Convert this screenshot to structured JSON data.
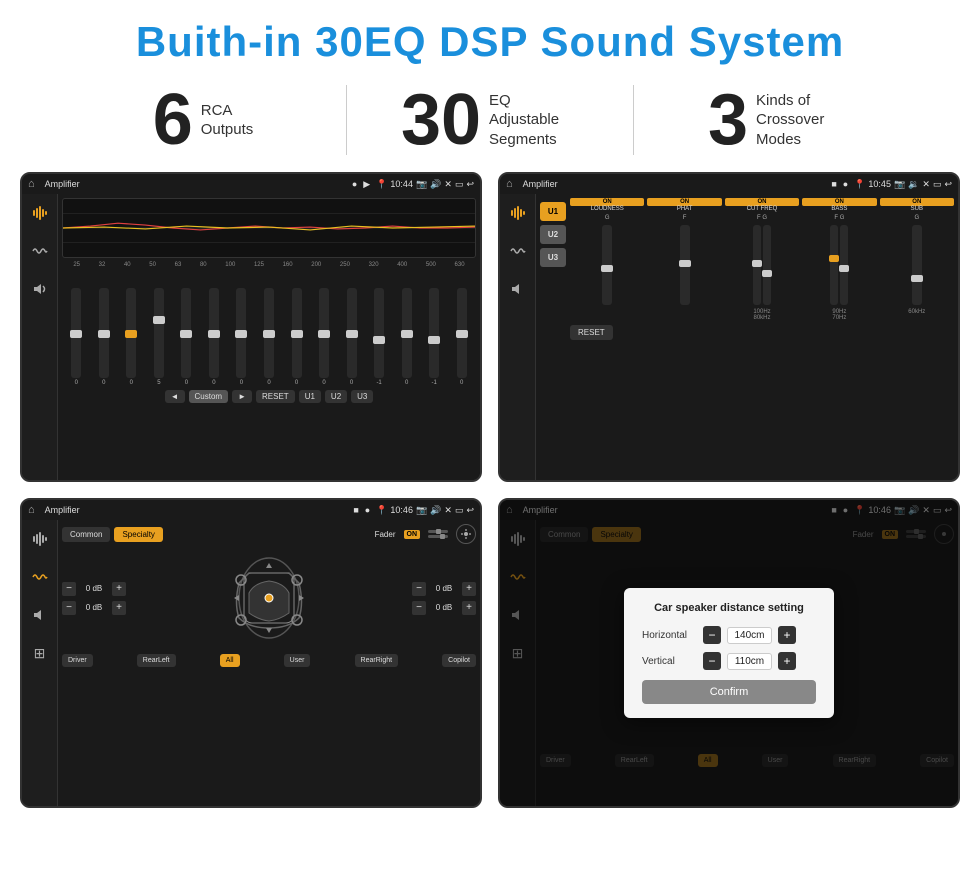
{
  "header": {
    "title": "Buith-in 30EQ DSP Sound System"
  },
  "stats": [
    {
      "number": "6",
      "label": "RCA\nOutputs"
    },
    {
      "number": "30",
      "label": "EQ Adjustable\nSegments"
    },
    {
      "number": "3",
      "label": "Kinds of\nCrossover Modes"
    }
  ],
  "screens": [
    {
      "id": "screen1",
      "statusbar": {
        "time": "10:44",
        "title": "Amplifier"
      },
      "type": "eq"
    },
    {
      "id": "screen2",
      "statusbar": {
        "time": "10:45",
        "title": "Amplifier"
      },
      "type": "crossover"
    },
    {
      "id": "screen3",
      "statusbar": {
        "time": "10:46",
        "title": "Amplifier"
      },
      "type": "fader"
    },
    {
      "id": "screen4",
      "statusbar": {
        "time": "10:46",
        "title": "Amplifier"
      },
      "type": "fader-dialog"
    }
  ],
  "eq": {
    "frequencies": [
      "25",
      "32",
      "40",
      "50",
      "63",
      "80",
      "100",
      "125",
      "160",
      "200",
      "250",
      "320",
      "400",
      "500",
      "630"
    ],
    "values": [
      "0",
      "0",
      "0",
      "5",
      "0",
      "0",
      "0",
      "0",
      "0",
      "0",
      "0",
      "-1",
      "0",
      "-1",
      "0"
    ],
    "sliderPositions": [
      45,
      45,
      45,
      30,
      45,
      45,
      45,
      45,
      45,
      45,
      45,
      55,
      45,
      55,
      45
    ],
    "presets": [
      "Custom",
      "RESET",
      "U1",
      "U2",
      "U3"
    ]
  },
  "crossover": {
    "uButtons": [
      "U1",
      "U2",
      "U3"
    ],
    "controls": [
      {
        "label": "LOUDNESS",
        "on": true
      },
      {
        "label": "PHAT",
        "on": true
      },
      {
        "label": "CUT FREQ",
        "on": true
      },
      {
        "label": "BASS",
        "on": true
      },
      {
        "label": "SUB",
        "on": true
      }
    ],
    "resetLabel": "RESET"
  },
  "fader": {
    "tabs": [
      "Common",
      "Specialty"
    ],
    "activeTab": "Specialty",
    "faderLabel": "Fader",
    "onLabel": "ON",
    "dbValues": [
      "0 dB",
      "0 dB",
      "0 dB",
      "0 dB"
    ],
    "bottomButtons": [
      "Driver",
      "RearLeft",
      "All",
      "User",
      "RearRight",
      "Copilot"
    ]
  },
  "dialog": {
    "title": "Car speaker distance setting",
    "rows": [
      {
        "label": "Horizontal",
        "value": "140cm"
      },
      {
        "label": "Vertical",
        "value": "110cm"
      }
    ],
    "confirmLabel": "Confirm"
  }
}
